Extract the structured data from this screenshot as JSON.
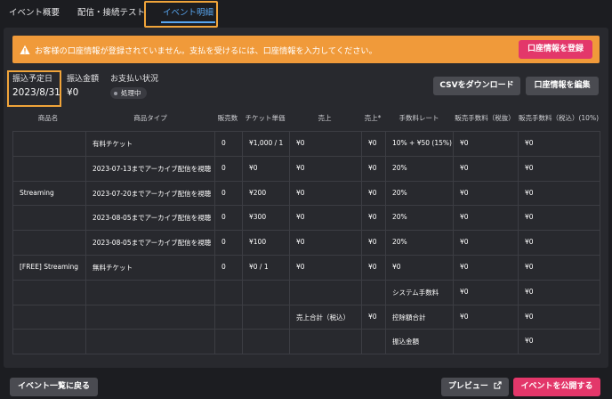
{
  "tabs": [
    "イベント概要",
    "配信・接続テスト",
    "イベント明細"
  ],
  "alert": {
    "message": "お客様の口座情報が登録されていません。支払を受けるには、口座情報を入力してください。",
    "button": "口座情報を登録"
  },
  "summary": {
    "date_label": "振込予定日",
    "date_value": "2023/8/31",
    "amount_label": "振込金額",
    "amount_value": "¥0",
    "status_label": "お支払い状況",
    "status_badge": "処理中"
  },
  "actions": {
    "csv": "CSVをダウンロード",
    "edit_account": "口座情報を編集"
  },
  "table": {
    "headers": [
      "商品名",
      "商品タイプ",
      "販売数",
      "チケット単価",
      "売上",
      "売上*",
      "手数料レート",
      "販売手数料（税抜）",
      "販売手数料（税込）(10%)"
    ],
    "groups": [
      "Streaming",
      "[FREE] Streaming"
    ],
    "rows": [
      [
        "有料チケット",
        "0",
        "¥1,000 / 1",
        "¥0",
        "¥0",
        "10% + ¥50 (15%)",
        "¥0",
        "¥0"
      ],
      [
        "2023-07-13までアーカイブ配信を視聴",
        "0",
        "¥0",
        "¥0",
        "¥0",
        "20%",
        "¥0",
        "¥0"
      ],
      [
        "2023-07-20までアーカイブ配信を視聴",
        "0",
        "¥200",
        "¥0",
        "¥0",
        "20%",
        "¥0",
        "¥0"
      ],
      [
        "2023-08-05までアーカイブ配信を視聴",
        "0",
        "¥300",
        "¥0",
        "¥0",
        "20%",
        "¥0",
        "¥0"
      ],
      [
        "2023-08-05までアーカイブ配信を視聴",
        "0",
        "¥100",
        "¥0",
        "¥0",
        "20%",
        "¥0",
        "¥0"
      ],
      [
        "無料チケット",
        "0",
        "¥0 / 1",
        "¥0",
        "¥0",
        "¥0",
        "¥0",
        "¥0"
      ]
    ],
    "summary_rows": [
      [
        "システム手数料",
        "¥0",
        "¥0"
      ],
      [
        "控除額合計",
        "¥0",
        "¥0"
      ],
      [
        "振込金額",
        "",
        "¥0"
      ]
    ],
    "total_label": "売上合計（税込）",
    "total_value": "¥0"
  },
  "footer": {
    "back": "イベント一覧に戻る",
    "preview": "プレビュー",
    "publish": "イベントを公開する"
  },
  "colors": {
    "alert": "#f09a3a",
    "primary": "#e3376a",
    "highlight": "#f0a43a",
    "tab_active": "#58a6f0"
  }
}
